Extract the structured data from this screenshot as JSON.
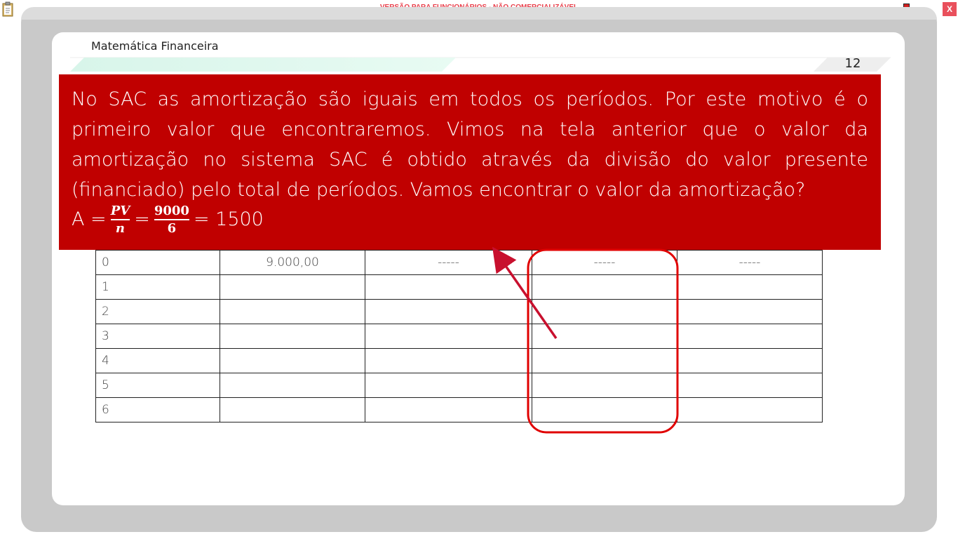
{
  "window": {
    "banner": "VERSÃO PARA FUNCIONÁRIOS - NÃO COMERCIALIZÁVEL",
    "close_label": "X"
  },
  "header": {
    "course_title": "Matemática Financeira",
    "page_number": "12"
  },
  "callout": {
    "text": "No SAC as amortização são iguais em todos os períodos. Por este motivo é o primeiro valor que encontraremos. Vimos na tela anterior que o valor da amortização no sistema SAC é obtido através da divisão do valor presente (financiado) pelo total de períodos. Vamos encontrar o valor da amortização?",
    "formula_lhs": "A =",
    "formula_num1": "PV",
    "formula_den1": "n",
    "formula_eq": "=",
    "formula_num2": "9000",
    "formula_den2": "6",
    "formula_result": "= 1500"
  },
  "table": {
    "rows": [
      [
        "0",
        "9.000,00",
        "-----",
        "-----",
        "-----"
      ],
      [
        "1",
        "",
        "",
        "",
        ""
      ],
      [
        "2",
        "",
        "",
        "",
        ""
      ],
      [
        "3",
        "",
        "",
        "",
        ""
      ],
      [
        "4",
        "",
        "",
        "",
        ""
      ],
      [
        "5",
        "",
        "",
        "",
        ""
      ],
      [
        "6",
        "",
        "",
        "",
        ""
      ]
    ]
  },
  "colors": {
    "callout_bg": "#c00000",
    "highlight_stroke": "#e00000",
    "arrow": "#c8102e",
    "frame": "#c9c9c9"
  },
  "icons": {
    "left": "clipboard-icon",
    "right": "network-status-icon"
  }
}
